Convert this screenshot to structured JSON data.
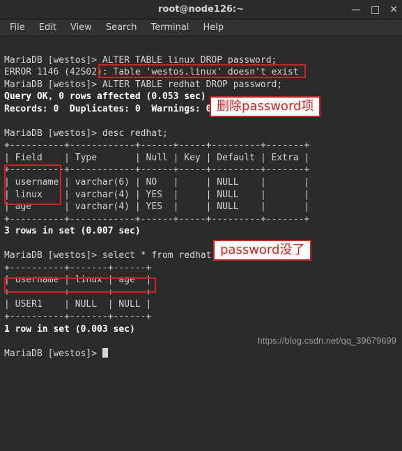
{
  "titlebar": {
    "title": "root@node126:~"
  },
  "menubar": {
    "file": "File",
    "edit": "Edit",
    "view": "View",
    "search": "Search",
    "terminal": "Terminal",
    "help": "Help"
  },
  "lines": {
    "l1_prompt": "MariaDB [westos]> ",
    "l1_cmd": "ALTER TABLE linux DROP password;",
    "l2": "ERROR 1146 (42S02): Table 'westos.linux' doesn't exist",
    "l3_prompt": "MariaDB [westos]> ",
    "l3_cmd": "ALTER TABLE redhat DROP password;",
    "l4": "Query OK, 0 rows affected (0.053 sec)",
    "l5": "Records: 0  Duplicates: 0  Warnings: 0",
    "l6": "",
    "l7_prompt": "MariaDB [westos]> ",
    "l7_cmd": "desc redhat;",
    "t1_border_top": "+----------+------------+------+-----+---------+-------+",
    "t1_header": "| Field    | Type       | Null | Key | Default | Extra |",
    "t1_border_mid": "+----------+------------+------+-----+---------+-------+",
    "t1_row1": "| username | varchar(6) | NO   |     | NULL    |       |",
    "t1_row2": "| linux    | varchar(4) | YES  |     | NULL    |       |",
    "t1_row3": "| age      | varchar(4) | YES  |     | NULL    |       |",
    "t1_border_bot": "+----------+------------+------+-----+---------+-------+",
    "t1_summary": "3 rows in set (0.007 sec)",
    "l_blank2": "",
    "l8_prompt": "MariaDB [westos]> ",
    "l8_cmd": "select * from redhat;",
    "t2_border_top": "+----------+-------+------+",
    "t2_header": "| username | linux | age  |",
    "t2_border_mid": "+----------+-------+------+",
    "t2_row1": "| USER1    | NULL  | NULL |",
    "t2_border_bot": "+----------+-------+------+",
    "t2_summary": "1 row in set (0.003 sec)",
    "l_blank3": "",
    "l9_prompt": "MariaDB [westos]> "
  },
  "annotations": {
    "label1": "删除password项",
    "label2": "password没了"
  },
  "watermark": "https://blog.csdn.net/qq_39679699"
}
